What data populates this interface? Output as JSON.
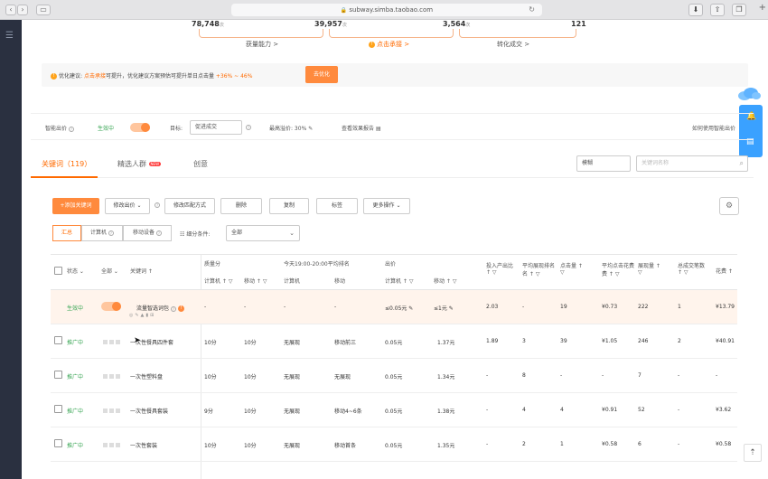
{
  "browser": {
    "url": "subway.simba.taobao.com"
  },
  "funnel": {
    "metrics": [
      {
        "value": "78,748",
        "unit": "次"
      },
      {
        "value": "39,957",
        "unit": "次"
      },
      {
        "value": "3,564",
        "unit": "次"
      },
      {
        "value": "121",
        "unit": ""
      }
    ],
    "stages": [
      "获量能力 >",
      "点击承接 >",
      "转化成交 >"
    ]
  },
  "suggestion": {
    "prefix": "优化建议: ",
    "link": "点击承接",
    "middle": "可提升，优化建议方案预估可提升单日点击量",
    "pct": "+36% ~ 46%",
    "button": "去优化"
  },
  "smart_bid": {
    "label": "智能出价",
    "status": "生效中",
    "goal_label": "目标:",
    "goal_value": "促进成交",
    "max_premium": "最高溢价: 30%",
    "report": "查看效果报告",
    "help": "如何使用智能出价"
  },
  "tabs": {
    "keywords": "关键词（119）",
    "crowd": "精选人群",
    "crowd_badge": "NEW",
    "creative": "创意"
  },
  "search": {
    "mode": "模糊",
    "placeholder": "关键词名称"
  },
  "toolbar": {
    "add": "+添加关键词",
    "modify_bid": "修改出价",
    "modify_match": "修改匹配方式",
    "delete": "删除",
    "copy": "复制",
    "tag": "标签",
    "more": "更多操作"
  },
  "filters": {
    "summary": "汇总",
    "pc": "计算机",
    "mobile": "移动设备",
    "split_label": "细分条件:",
    "split_value": "全部"
  },
  "table": {
    "headers": {
      "status": "状态",
      "all": "全部",
      "keyword": "关键词",
      "quality": "质量分",
      "quality_pc": "计算机",
      "quality_mobile": "移动",
      "rank": "今天19:00-20:00平均排名",
      "rank_pc": "计算机",
      "rank_mobile": "移动",
      "bid": "出价",
      "bid_pc": "计算机",
      "bid_mobile": "移动",
      "roi": "投入产出比",
      "avg_rank": "平均展现排名",
      "clicks": "点击量",
      "avg_cpc": "平均点击花费",
      "impressions": "展现量",
      "deals": "总成交笔数",
      "cost": "花费"
    },
    "rows": [
      {
        "status": "生效中",
        "keyword": "流量智选词包",
        "q_pc": "-",
        "q_mob": "-",
        "r_pc": "-",
        "r_mob": "-",
        "b_pc": "≤0.05元",
        "b_mob": "≤1元",
        "roi": "2.03",
        "avg_rank": "-",
        "clicks": "19",
        "cpc": "¥0.73",
        "imp": "222",
        "deals": "1",
        "cost": "¥13.79"
      },
      {
        "status": "推广中",
        "keyword": "一次性餐具四件套",
        "q_pc": "10分",
        "q_mob": "10分",
        "r_pc": "无展现",
        "r_mob": "移动前三",
        "b_pc": "0.05元",
        "b_mob": "1.37元",
        "roi": "1.89",
        "avg_rank": "3",
        "clicks": "39",
        "cpc": "¥1.05",
        "imp": "246",
        "deals": "2",
        "cost": "¥40.91"
      },
      {
        "status": "推广中",
        "keyword": "一次性塑料盘",
        "q_pc": "10分",
        "q_mob": "10分",
        "r_pc": "无展现",
        "r_mob": "无展现",
        "b_pc": "0.05元",
        "b_mob": "1.34元",
        "roi": "-",
        "avg_rank": "8",
        "clicks": "-",
        "cpc": "-",
        "imp": "7",
        "deals": "-",
        "cost": "-"
      },
      {
        "status": "推广中",
        "keyword": "一次性餐具套装",
        "q_pc": "9分",
        "q_mob": "10分",
        "r_pc": "无展现",
        "r_mob": "移动4~6条",
        "b_pc": "0.05元",
        "b_mob": "1.38元",
        "roi": "-",
        "avg_rank": "4",
        "clicks": "4",
        "cpc": "¥0.91",
        "imp": "52",
        "deals": "-",
        "cost": "¥3.62"
      },
      {
        "status": "推广中",
        "keyword": "一次性套装",
        "q_pc": "10分",
        "q_mob": "10分",
        "r_pc": "无展现",
        "r_mob": "移动首条",
        "b_pc": "0.05元",
        "b_mob": "1.35元",
        "roi": "-",
        "avg_rank": "2",
        "clicks": "1",
        "cpc": "¥0.58",
        "imp": "6",
        "deals": "-",
        "cost": "¥0.58"
      }
    ]
  }
}
